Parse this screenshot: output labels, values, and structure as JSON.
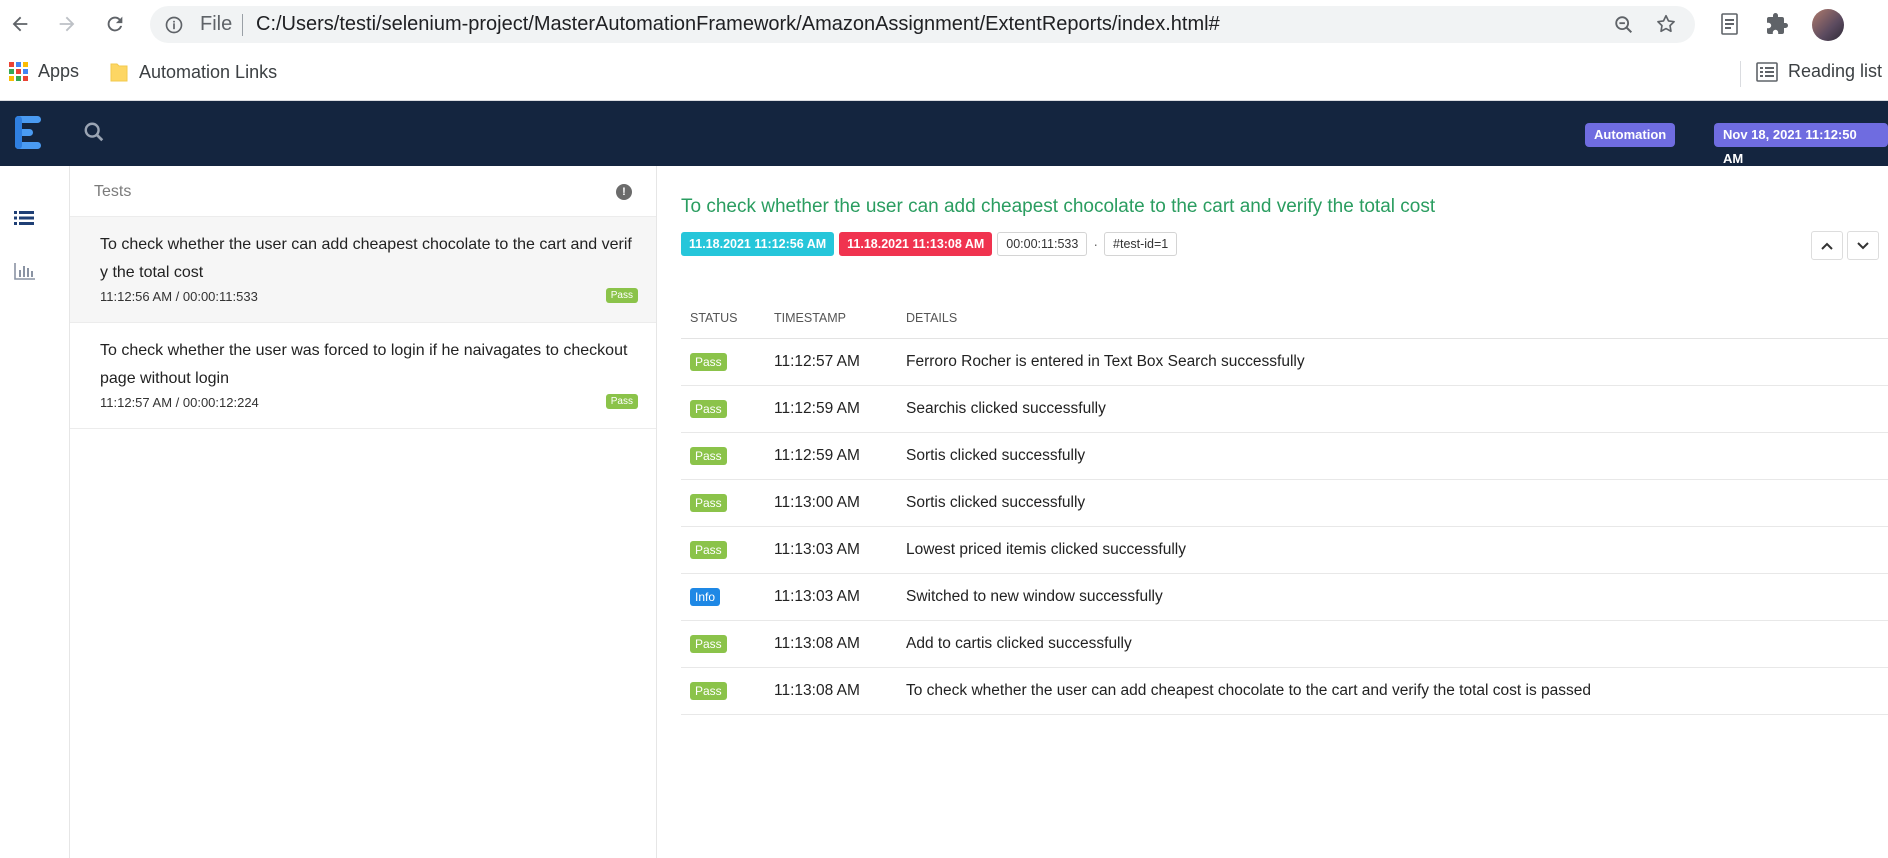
{
  "browser": {
    "omnibox_scheme": "File",
    "url": "C:/Users/testi/selenium-project/MasterAutomationFramework/AmazonAssignment/ExtentReports/index.html#",
    "icons": [
      "back-icon",
      "forward-icon",
      "reload-icon",
      "info-icon",
      "zoom-icon",
      "star-icon",
      "extension-icon",
      "puzzle-icon"
    ]
  },
  "bookmarks": {
    "apps_label": "Apps",
    "folder_label": "Automation Links",
    "reading_list_label": "Reading list"
  },
  "topbar": {
    "badge_automation": "Automation",
    "badge_date": "Nov 18, 2021 11:12:50 AM",
    "accent": "#6f6ce0",
    "background": "#14253f"
  },
  "tests_panel": {
    "title": "Tests",
    "info_glyph": "!",
    "items": [
      {
        "name": "To check whether the user can add cheapest chocolate to the cart and verif y the total cost",
        "meta": "11:12:56 AM / 00:00:11:533",
        "status": "Pass"
      },
      {
        "name": "To check whether the user was forced to login if he naivagates to checkout page without login",
        "meta": "11:12:57 AM / 00:00:12:224",
        "status": "Pass"
      }
    ]
  },
  "detail": {
    "title": "To check whether the user can add cheapest chocolate to the cart and verify the total cost",
    "start_time": "11.18.2021 11:12:56 AM",
    "end_time": "11.18.2021 11:13:08 AM",
    "duration": "00:00:11:533",
    "separator": "·",
    "test_id": "#test-id=1",
    "columns": {
      "status": "STATUS",
      "timestamp": "TIMESTAMP",
      "details": "DETAILS"
    },
    "logs": [
      {
        "status": "Pass",
        "timestamp": "11:12:57 AM",
        "details": "Ferroro Rocher is entered in Text Box Search successfully"
      },
      {
        "status": "Pass",
        "timestamp": "11:12:59 AM",
        "details": "Searchis clicked successfully"
      },
      {
        "status": "Pass",
        "timestamp": "11:12:59 AM",
        "details": "Sortis clicked successfully"
      },
      {
        "status": "Pass",
        "timestamp": "11:13:00 AM",
        "details": "Sortis clicked successfully"
      },
      {
        "status": "Pass",
        "timestamp": "11:13:03 AM",
        "details": "Lowest priced itemis clicked successfully"
      },
      {
        "status": "Info",
        "timestamp": "11:13:03 AM",
        "details": "Switched to new window successfully"
      },
      {
        "status": "Pass",
        "timestamp": "11:13:08 AM",
        "details": "Add to cartis clicked successfully"
      },
      {
        "status": "Pass",
        "timestamp": "11:13:08 AM",
        "details": "To check whether the user can add cheapest chocolate to the cart and verify the total cost is passed"
      }
    ],
    "status_colors": {
      "pass": "#8bc34a",
      "info": "#1e88e5",
      "title": "#2a9d60"
    }
  }
}
